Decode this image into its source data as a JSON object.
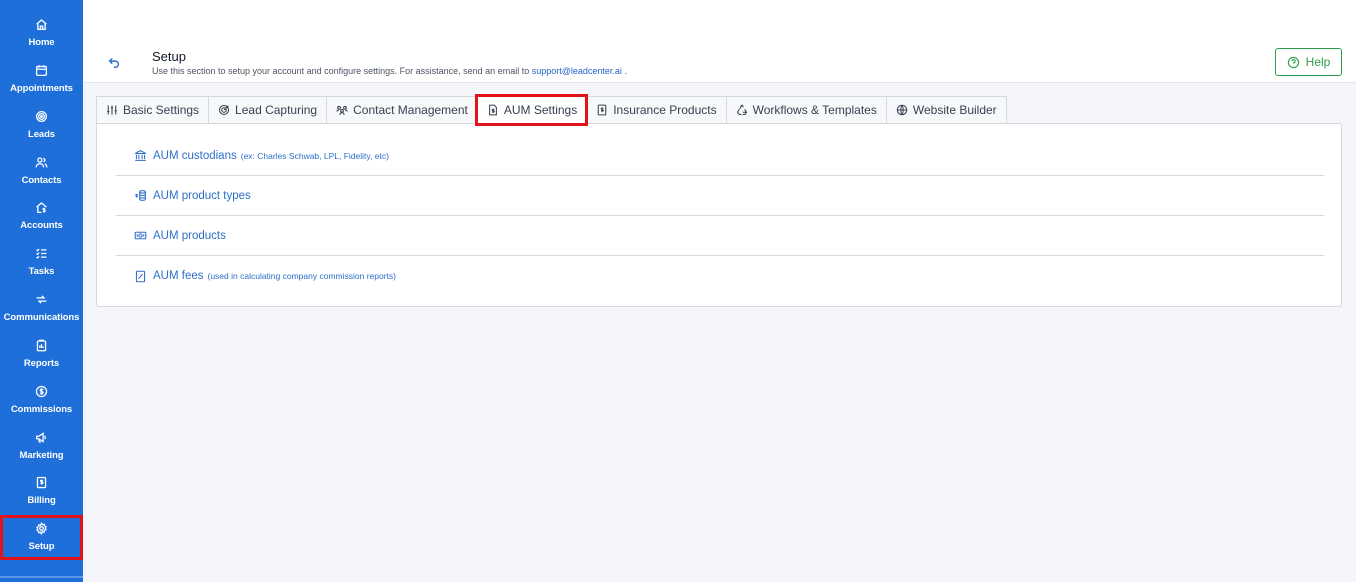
{
  "sidebar": {
    "items": [
      {
        "label": "Home",
        "icon": "home-icon"
      },
      {
        "label": "Appointments",
        "icon": "calendar-icon"
      },
      {
        "label": "Leads",
        "icon": "target-icon"
      },
      {
        "label": "Contacts",
        "icon": "users-icon"
      },
      {
        "label": "Accounts",
        "icon": "house-dollar-icon"
      },
      {
        "label": "Tasks",
        "icon": "checklist-icon"
      },
      {
        "label": "Communications",
        "icon": "arrows-icon"
      },
      {
        "label": "Reports",
        "icon": "clipboard-icon"
      },
      {
        "label": "Commissions",
        "icon": "dollar-circle-icon"
      },
      {
        "label": "Marketing",
        "icon": "megaphone-icon"
      },
      {
        "label": "Billing",
        "icon": "invoice-icon"
      },
      {
        "label": "Setup",
        "icon": "gear-icon"
      }
    ],
    "active": "Setup",
    "color": "#1e6fd9"
  },
  "header": {
    "title": "Setup",
    "subtitle_prefix": "Use this section to setup your account and configure settings. For assistance, send an email to",
    "email": "support@leadcenter.ai",
    "subtitle_suffix": ".",
    "help_label": "Help"
  },
  "tabs": [
    {
      "label": "Basic Settings",
      "icon": "sliders-icon"
    },
    {
      "label": "Lead Capturing",
      "icon": "target-check-icon"
    },
    {
      "label": "Contact Management",
      "icon": "people-icon"
    },
    {
      "label": "AUM Settings",
      "icon": "file-dollar-icon",
      "active": true
    },
    {
      "label": "Insurance Products",
      "icon": "document-dollar-icon"
    },
    {
      "label": "Workflows & Templates",
      "icon": "recycle-icon"
    },
    {
      "label": "Website Builder",
      "icon": "globe-icon"
    }
  ],
  "aum_items": [
    {
      "label": "AUM custodians",
      "hint": "(ex: Charles Schwab, LPL, Fidelity, etc)",
      "icon": "bank-icon"
    },
    {
      "label": "AUM product types",
      "hint": "",
      "icon": "coins-dollar-icon"
    },
    {
      "label": "AUM products",
      "hint": "",
      "icon": "money-bill-icon"
    },
    {
      "label": "AUM fees",
      "hint": "(used in calculating company commission reports)",
      "icon": "percent-doc-icon"
    }
  ],
  "colors": {
    "accent": "#2c6fc7",
    "help": "#2e9d4a",
    "highlight": "#e1141c"
  }
}
